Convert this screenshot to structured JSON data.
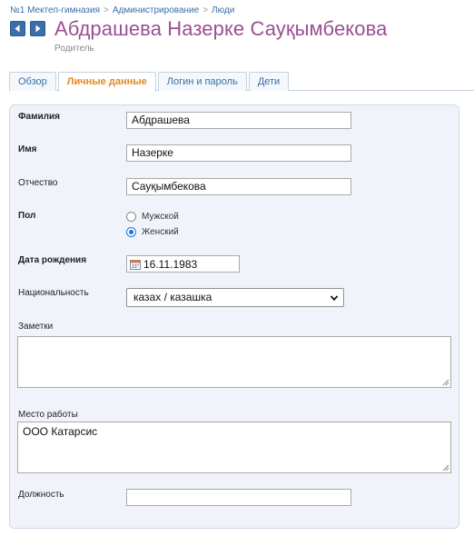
{
  "breadcrumb": {
    "items": [
      "№1 Мектеп-гимназия",
      "Администрирование",
      "Люди"
    ],
    "separator": ">"
  },
  "header": {
    "name": "Абдрашева Назерке Сауқымбекова",
    "role": "Родитель"
  },
  "tabs": [
    {
      "label": "Обзор",
      "active": false
    },
    {
      "label": "Личные данные",
      "active": true
    },
    {
      "label": "Логин и пароль",
      "active": false
    },
    {
      "label": "Дети",
      "active": false
    }
  ],
  "form": {
    "last_name": {
      "label": "Фамилия",
      "value": "Абдрашева"
    },
    "first_name": {
      "label": "Имя",
      "value": "Назерке"
    },
    "patronymic": {
      "label": "Отчество",
      "value": "Сауқымбекова"
    },
    "gender": {
      "label": "Пол",
      "options": [
        {
          "label": "Мужской",
          "checked": false
        },
        {
          "label": "Женский",
          "checked": true
        }
      ]
    },
    "birth_date": {
      "label": "Дата рождения",
      "value": "16.11.1983"
    },
    "nationality": {
      "label": "Национальность",
      "value": "казах / казашка"
    },
    "notes": {
      "label": "Заметки",
      "value": ""
    },
    "workplace": {
      "label": "Место работы",
      "value": "ООО Катарсис"
    },
    "position": {
      "label": "Должность",
      "value": ""
    }
  },
  "colors": {
    "name": "#9b4f93",
    "link": "#3a6ea5",
    "active_tab": "#e08a1e",
    "panel_bg": "#f0f4fa",
    "nav_button": "#3b6ea8"
  },
  "icons": {
    "prev": "arrow-left-icon",
    "next": "arrow-right-icon",
    "calendar": "calendar-icon",
    "dropdown": "chevron-down-icon"
  }
}
